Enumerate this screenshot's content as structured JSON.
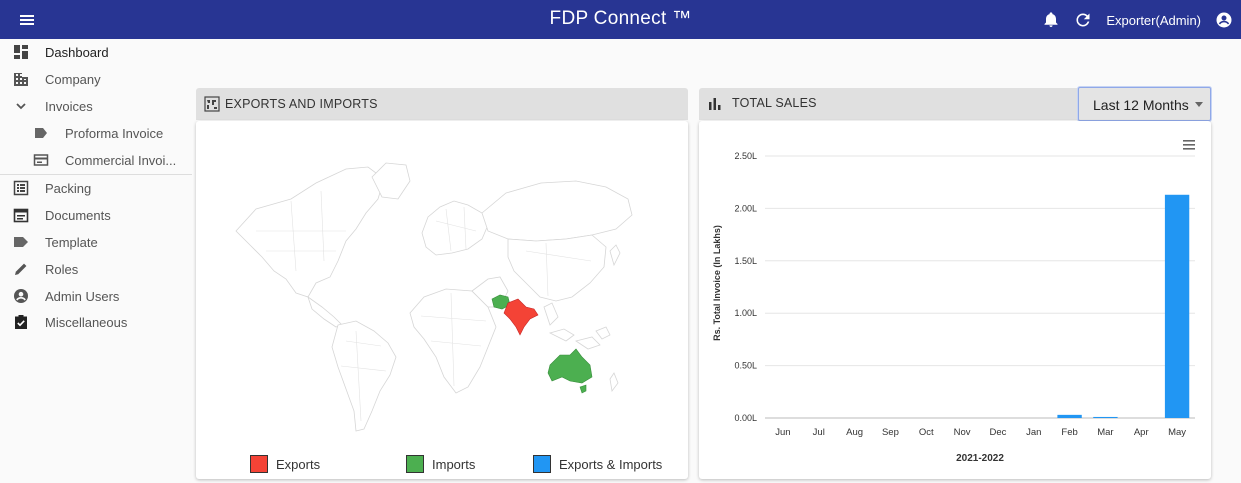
{
  "header": {
    "title": "FDP Connect ™",
    "user_label": "Exporter(Admin)",
    "icons": [
      "menu-icon",
      "bell-icon",
      "refresh-icon",
      "account-circle-icon"
    ],
    "bar_color": "#283593"
  },
  "sidebar": {
    "items": [
      {
        "label": "Dashboard",
        "icon": "dashboard-icon"
      },
      {
        "label": "Company",
        "icon": "building-icon"
      },
      {
        "label": "Invoices",
        "icon": "chevron-down-icon"
      },
      {
        "label": "Proforma Invoice",
        "icon": "label-icon"
      },
      {
        "label": "Commercial Invoi...",
        "icon": "card-icon"
      },
      {
        "label": "Packing",
        "icon": "list-icon"
      },
      {
        "label": "Documents",
        "icon": "calendar-icon"
      },
      {
        "label": "Template",
        "icon": "label-icon"
      },
      {
        "label": "Roles",
        "icon": "pencil-icon"
      },
      {
        "label": "Admin Users",
        "icon": "account-circle-icon"
      },
      {
        "label": "Miscellaneous",
        "icon": "clipboard-check-icon"
      }
    ]
  },
  "exports_panel": {
    "title": "EXPORTS AND IMPORTS",
    "icon": "world-map-icon",
    "legend": [
      {
        "label": "Exports",
        "color": "#f44336"
      },
      {
        "label": "Imports",
        "color": "#4caf50"
      },
      {
        "label": "Exports & Imports",
        "color": "#2196f3"
      }
    ]
  },
  "sales_panel": {
    "title": "TOTAL SALES",
    "icon": "bar-chart-icon",
    "period_select": {
      "value": "Last 12 Months"
    },
    "menu_icon": "hamburger-menu-icon"
  },
  "chart_data": {
    "type": "bar",
    "title": "",
    "xlabel": "2021-2022",
    "ylabel": "Rs. Total Invoice (In Lakhs)",
    "categories": [
      "Jun",
      "Jul",
      "Aug",
      "Sep",
      "Oct",
      "Nov",
      "Dec",
      "Jan",
      "Feb",
      "Mar",
      "Apr",
      "May"
    ],
    "values": [
      0,
      0,
      0,
      0,
      0,
      0,
      0,
      0,
      0.03,
      0.01,
      0,
      2.13
    ],
    "ylim": [
      0,
      2.5
    ],
    "yticks": [
      0,
      0.5,
      1.0,
      1.5,
      2.0,
      2.5
    ],
    "ytick_labels": [
      "0.00L",
      "0.50L",
      "1.00L",
      "1.50L",
      "2.00L",
      "2.50L"
    ],
    "bar_color": "#2196f3",
    "grid": true,
    "legend": "none"
  }
}
